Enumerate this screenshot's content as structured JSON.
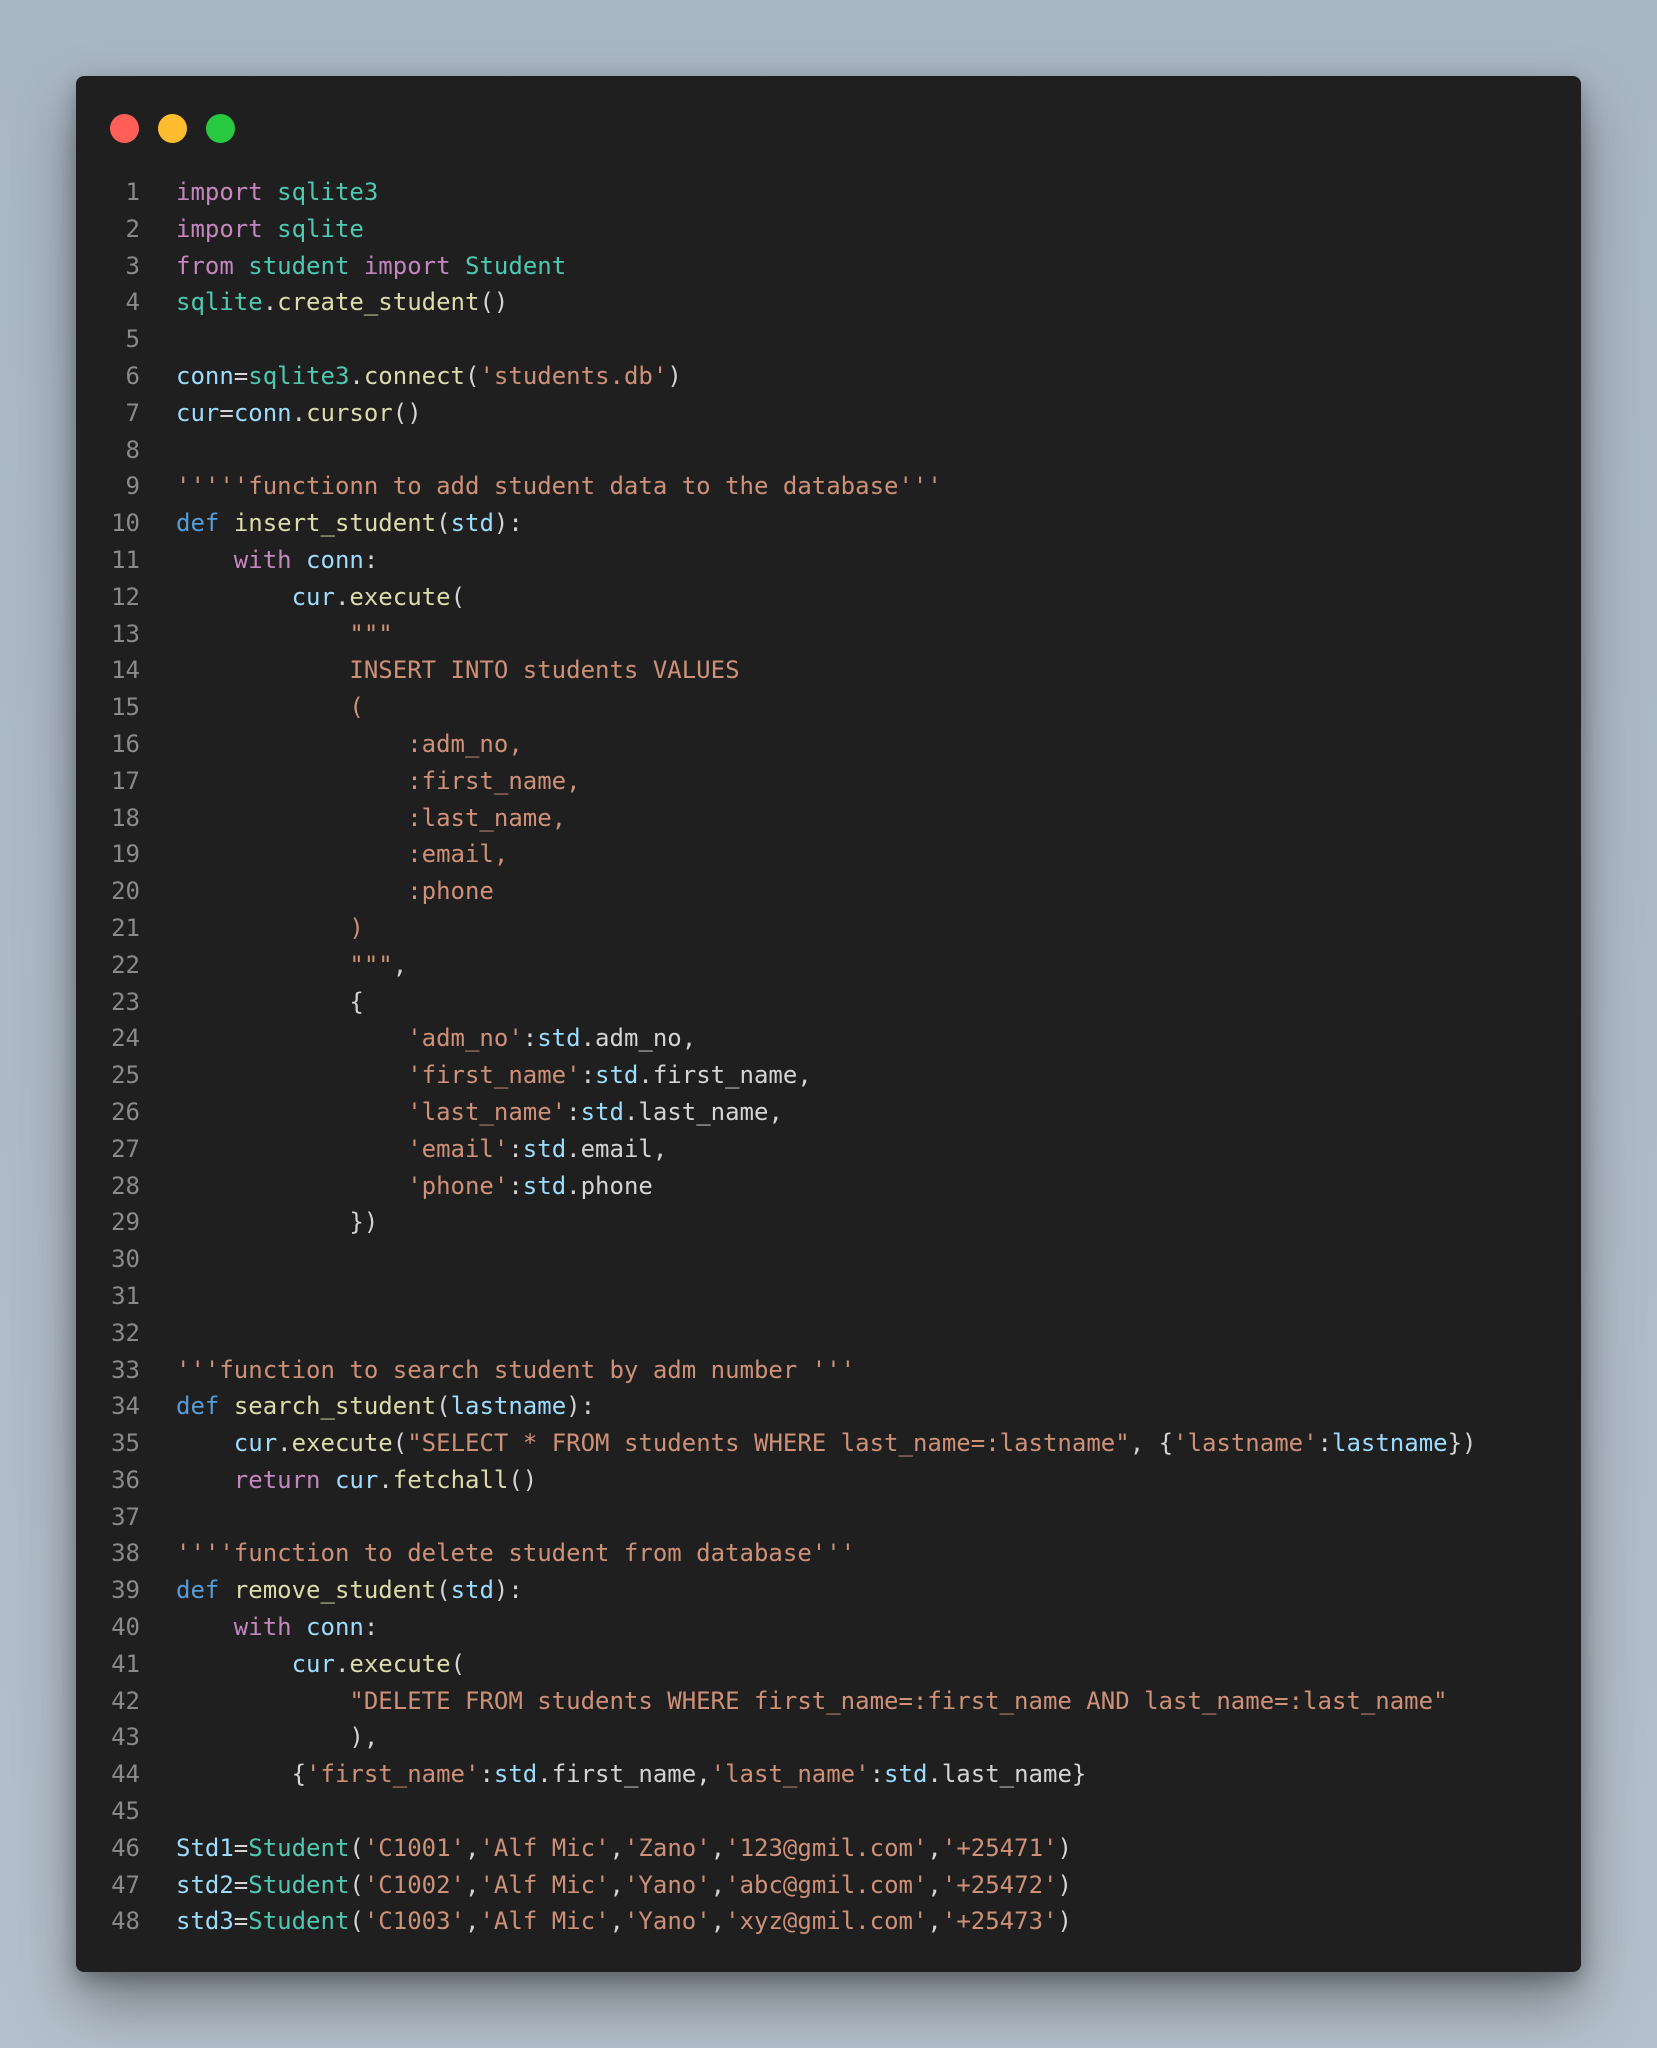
{
  "window": {
    "controls": [
      "close",
      "minimize",
      "maximize"
    ],
    "colors": {
      "close": "#ff5f57",
      "minimize": "#febc2e",
      "maximize": "#28c840"
    }
  },
  "code": {
    "language": "python",
    "lines": [
      {
        "n": "1",
        "t": [
          [
            "kw",
            "import"
          ],
          [
            "pl",
            " "
          ],
          [
            "mod",
            "sqlite3"
          ]
        ]
      },
      {
        "n": "2",
        "t": [
          [
            "kw",
            "import"
          ],
          [
            "pl",
            " "
          ],
          [
            "mod",
            "sqlite"
          ]
        ]
      },
      {
        "n": "3",
        "t": [
          [
            "kw",
            "from"
          ],
          [
            "pl",
            " "
          ],
          [
            "mod",
            "student"
          ],
          [
            "pl",
            " "
          ],
          [
            "kw",
            "import"
          ],
          [
            "pl",
            " "
          ],
          [
            "mod",
            "Student"
          ]
        ]
      },
      {
        "n": "4",
        "t": [
          [
            "mod",
            "sqlite"
          ],
          [
            "pl",
            "."
          ],
          [
            "fn",
            "create_student"
          ],
          [
            "pl",
            "()"
          ]
        ]
      },
      {
        "n": "5",
        "t": []
      },
      {
        "n": "6",
        "t": [
          [
            "var",
            "conn"
          ],
          [
            "pl",
            "="
          ],
          [
            "mod",
            "sqlite3"
          ],
          [
            "pl",
            "."
          ],
          [
            "fn",
            "connect"
          ],
          [
            "pl",
            "("
          ],
          [
            "str",
            "'students.db'"
          ],
          [
            "pl",
            ")"
          ]
        ]
      },
      {
        "n": "7",
        "t": [
          [
            "var",
            "cur"
          ],
          [
            "pl",
            "="
          ],
          [
            "var",
            "conn"
          ],
          [
            "pl",
            "."
          ],
          [
            "fn",
            "cursor"
          ],
          [
            "pl",
            "()"
          ]
        ]
      },
      {
        "n": "8",
        "t": []
      },
      {
        "n": "9",
        "t": [
          [
            "str",
            "'''''functionn to add student data to the database'''"
          ]
        ]
      },
      {
        "n": "10",
        "t": [
          [
            "def",
            "def"
          ],
          [
            "pl",
            " "
          ],
          [
            "fn",
            "insert_student"
          ],
          [
            "pl",
            "("
          ],
          [
            "var",
            "std"
          ],
          [
            "pl",
            "):"
          ]
        ]
      },
      {
        "n": "11",
        "t": [
          [
            "pl",
            "    "
          ],
          [
            "kw",
            "with"
          ],
          [
            "pl",
            " "
          ],
          [
            "var",
            "conn"
          ],
          [
            "pl",
            ":"
          ]
        ]
      },
      {
        "n": "12",
        "t": [
          [
            "pl",
            "        "
          ],
          [
            "var",
            "cur"
          ],
          [
            "pl",
            "."
          ],
          [
            "fn",
            "execute"
          ],
          [
            "pl",
            "("
          ]
        ]
      },
      {
        "n": "13",
        "t": [
          [
            "pl",
            "            "
          ],
          [
            "str",
            "\"\"\""
          ]
        ]
      },
      {
        "n": "14",
        "t": [
          [
            "pl",
            "            "
          ],
          [
            "str",
            "INSERT INTO students VALUES"
          ]
        ]
      },
      {
        "n": "15",
        "t": [
          [
            "pl",
            "            "
          ],
          [
            "str",
            "("
          ]
        ]
      },
      {
        "n": "16",
        "t": [
          [
            "pl",
            "                "
          ],
          [
            "str",
            ":adm_no,"
          ]
        ]
      },
      {
        "n": "17",
        "t": [
          [
            "pl",
            "                "
          ],
          [
            "str",
            ":first_name,"
          ]
        ]
      },
      {
        "n": "18",
        "t": [
          [
            "pl",
            "                "
          ],
          [
            "str",
            ":last_name,"
          ]
        ]
      },
      {
        "n": "19",
        "t": [
          [
            "pl",
            "                "
          ],
          [
            "str",
            ":email,"
          ]
        ]
      },
      {
        "n": "20",
        "t": [
          [
            "pl",
            "                "
          ],
          [
            "str",
            ":phone"
          ]
        ]
      },
      {
        "n": "21",
        "t": [
          [
            "pl",
            "            "
          ],
          [
            "str",
            ")"
          ]
        ]
      },
      {
        "n": "22",
        "t": [
          [
            "pl",
            "            "
          ],
          [
            "str",
            "\"\"\""
          ],
          [
            "pl",
            ","
          ]
        ]
      },
      {
        "n": "23",
        "t": [
          [
            "pl",
            "            {"
          ]
        ]
      },
      {
        "n": "24",
        "t": [
          [
            "pl",
            "                "
          ],
          [
            "str",
            "'adm_no'"
          ],
          [
            "pl",
            ":"
          ],
          [
            "var",
            "std"
          ],
          [
            "pl",
            ".adm_no,"
          ]
        ]
      },
      {
        "n": "25",
        "t": [
          [
            "pl",
            "                "
          ],
          [
            "str",
            "'first_name'"
          ],
          [
            "pl",
            ":"
          ],
          [
            "var",
            "std"
          ],
          [
            "pl",
            ".first_name,"
          ]
        ]
      },
      {
        "n": "26",
        "t": [
          [
            "pl",
            "                "
          ],
          [
            "str",
            "'last_name'"
          ],
          [
            "pl",
            ":"
          ],
          [
            "var",
            "std"
          ],
          [
            "pl",
            ".last_name,"
          ]
        ]
      },
      {
        "n": "27",
        "t": [
          [
            "pl",
            "                "
          ],
          [
            "str",
            "'email'"
          ],
          [
            "pl",
            ":"
          ],
          [
            "var",
            "std"
          ],
          [
            "pl",
            ".email,"
          ]
        ]
      },
      {
        "n": "28",
        "t": [
          [
            "pl",
            "                "
          ],
          [
            "str",
            "'phone'"
          ],
          [
            "pl",
            ":"
          ],
          [
            "var",
            "std"
          ],
          [
            "pl",
            ".phone"
          ]
        ]
      },
      {
        "n": "29",
        "t": [
          [
            "pl",
            "            })"
          ]
        ]
      },
      {
        "n": "30",
        "t": []
      },
      {
        "n": "31",
        "t": []
      },
      {
        "n": "32",
        "t": []
      },
      {
        "n": "33",
        "t": [
          [
            "str",
            "'''function to search student by adm number '''"
          ]
        ]
      },
      {
        "n": "34",
        "t": [
          [
            "def",
            "def"
          ],
          [
            "pl",
            " "
          ],
          [
            "fn",
            "search_student"
          ],
          [
            "pl",
            "("
          ],
          [
            "var",
            "lastname"
          ],
          [
            "pl",
            "):"
          ]
        ]
      },
      {
        "n": "35",
        "t": [
          [
            "pl",
            "    "
          ],
          [
            "var",
            "cur"
          ],
          [
            "pl",
            "."
          ],
          [
            "fn",
            "execute"
          ],
          [
            "pl",
            "("
          ],
          [
            "str",
            "\"SELECT * FROM students WHERE last_name=:lastname\""
          ],
          [
            "pl",
            ", {"
          ],
          [
            "str",
            "'lastname'"
          ],
          [
            "pl",
            ":"
          ],
          [
            "var",
            "lastname"
          ],
          [
            "pl",
            "})"
          ]
        ]
      },
      {
        "n": "36",
        "t": [
          [
            "pl",
            "    "
          ],
          [
            "kw",
            "return"
          ],
          [
            "pl",
            " "
          ],
          [
            "var",
            "cur"
          ],
          [
            "pl",
            "."
          ],
          [
            "fn",
            "fetchall"
          ],
          [
            "pl",
            "()"
          ]
        ]
      },
      {
        "n": "37",
        "t": []
      },
      {
        "n": "38",
        "t": [
          [
            "str",
            "''''function to delete student from database'''"
          ]
        ]
      },
      {
        "n": "39",
        "t": [
          [
            "def",
            "def"
          ],
          [
            "pl",
            " "
          ],
          [
            "fn",
            "remove_student"
          ],
          [
            "pl",
            "("
          ],
          [
            "var",
            "std"
          ],
          [
            "pl",
            "):"
          ]
        ]
      },
      {
        "n": "40",
        "t": [
          [
            "pl",
            "    "
          ],
          [
            "kw",
            "with"
          ],
          [
            "pl",
            " "
          ],
          [
            "var",
            "conn"
          ],
          [
            "pl",
            ":"
          ]
        ]
      },
      {
        "n": "41",
        "t": [
          [
            "pl",
            "        "
          ],
          [
            "var",
            "cur"
          ],
          [
            "pl",
            "."
          ],
          [
            "fn",
            "execute"
          ],
          [
            "pl",
            "("
          ]
        ]
      },
      {
        "n": "42",
        "t": [
          [
            "pl",
            "            "
          ],
          [
            "str",
            "\"DELETE FROM students WHERE first_name=:first_name AND last_name=:last_name\""
          ]
        ]
      },
      {
        "n": "43",
        "t": [
          [
            "pl",
            "            ),"
          ]
        ]
      },
      {
        "n": "44",
        "t": [
          [
            "pl",
            "        {"
          ],
          [
            "str",
            "'first_name'"
          ],
          [
            "pl",
            ":"
          ],
          [
            "var",
            "std"
          ],
          [
            "pl",
            ".first_name,"
          ],
          [
            "str",
            "'last_name'"
          ],
          [
            "pl",
            ":"
          ],
          [
            "var",
            "std"
          ],
          [
            "pl",
            ".last_name}"
          ]
        ]
      },
      {
        "n": "45",
        "t": []
      },
      {
        "n": "46",
        "t": [
          [
            "var",
            "Std1"
          ],
          [
            "pl",
            "="
          ],
          [
            "mod",
            "Student"
          ],
          [
            "pl",
            "("
          ],
          [
            "str",
            "'C1001'"
          ],
          [
            "pl",
            ","
          ],
          [
            "str",
            "'Alf Mic'"
          ],
          [
            "pl",
            ","
          ],
          [
            "str",
            "'Zano'"
          ],
          [
            "pl",
            ","
          ],
          [
            "str",
            "'123@gmil.com'"
          ],
          [
            "pl",
            ","
          ],
          [
            "str",
            "'+25471'"
          ],
          [
            "pl",
            ")"
          ]
        ]
      },
      {
        "n": "47",
        "t": [
          [
            "var",
            "std2"
          ],
          [
            "pl",
            "="
          ],
          [
            "mod",
            "Student"
          ],
          [
            "pl",
            "("
          ],
          [
            "str",
            "'C1002'"
          ],
          [
            "pl",
            ","
          ],
          [
            "str",
            "'Alf Mic'"
          ],
          [
            "pl",
            ","
          ],
          [
            "str",
            "'Yano'"
          ],
          [
            "pl",
            ","
          ],
          [
            "str",
            "'abc@gmil.com'"
          ],
          [
            "pl",
            ","
          ],
          [
            "str",
            "'+25472'"
          ],
          [
            "pl",
            ")"
          ]
        ]
      },
      {
        "n": "48",
        "t": [
          [
            "var",
            "std3"
          ],
          [
            "pl",
            "="
          ],
          [
            "mod",
            "Student"
          ],
          [
            "pl",
            "("
          ],
          [
            "str",
            "'C1003'"
          ],
          [
            "pl",
            ","
          ],
          [
            "str",
            "'Alf Mic'"
          ],
          [
            "pl",
            ","
          ],
          [
            "str",
            "'Yano'"
          ],
          [
            "pl",
            ","
          ],
          [
            "str",
            "'xyz@gmil.com'"
          ],
          [
            "pl",
            ","
          ],
          [
            "str",
            "'+25473'"
          ],
          [
            "pl",
            ")"
          ]
        ]
      }
    ]
  }
}
